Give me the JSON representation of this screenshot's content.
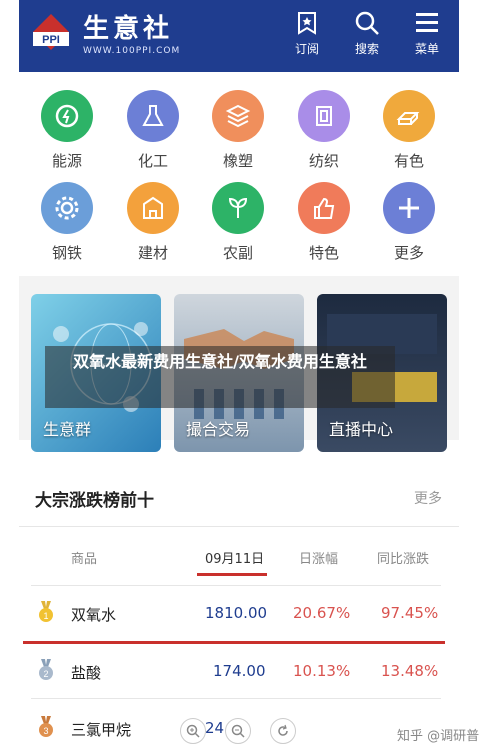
{
  "header": {
    "logo_text": "PPI",
    "brand": "生意社",
    "url": "WWW.100PPI.COM",
    "subscribe": "订阅",
    "search": "搜索",
    "menu": "菜单"
  },
  "categories": [
    {
      "label": "能源",
      "color": "#2db367",
      "icon": "recycle-icon"
    },
    {
      "label": "化工",
      "color": "#6c7fd6",
      "icon": "flask-icon"
    },
    {
      "label": "橡塑",
      "color": "#f08f5c",
      "icon": "layers-icon"
    },
    {
      "label": "纺织",
      "color": "#a98de8",
      "icon": "fabric-icon"
    },
    {
      "label": "有色",
      "color": "#f0a93c",
      "icon": "ingot-icon"
    },
    {
      "label": "钢铁",
      "color": "#6b9ed9",
      "icon": "gear-icon"
    },
    {
      "label": "建材",
      "color": "#f3a13c",
      "icon": "building-icon"
    },
    {
      "label": "农副",
      "color": "#2db367",
      "icon": "leaf-icon"
    },
    {
      "label": "特色",
      "color": "#f07b5a",
      "icon": "thumbs-up-icon"
    },
    {
      "label": "更多",
      "color": "#6c7fd6",
      "icon": "plus-icon"
    }
  ],
  "features": [
    {
      "label": "生意群"
    },
    {
      "label": "撮合交易"
    },
    {
      "label": "直播中心"
    }
  ],
  "overlay_title": "双氧水最新费用生意社/双氧水费用生意社",
  "ranking": {
    "title": "大宗涨跌榜前十",
    "more": "更多",
    "columns": [
      "商品",
      "09月11日",
      "日涨幅",
      "同比涨跌"
    ],
    "rows": [
      {
        "name": "双氧水",
        "price": "1810.00",
        "day": "20.67%",
        "yoy": "97.45%",
        "medal": "1"
      },
      {
        "name": "盐酸",
        "price": "174.00",
        "day": "10.13%",
        "yoy": "13.48%",
        "medal": "2"
      },
      {
        "name": "三氯甲烷",
        "price": "24",
        "day": "",
        "yoy": "",
        "medal": "3"
      }
    ]
  },
  "watermark": "知乎 @调研普"
}
